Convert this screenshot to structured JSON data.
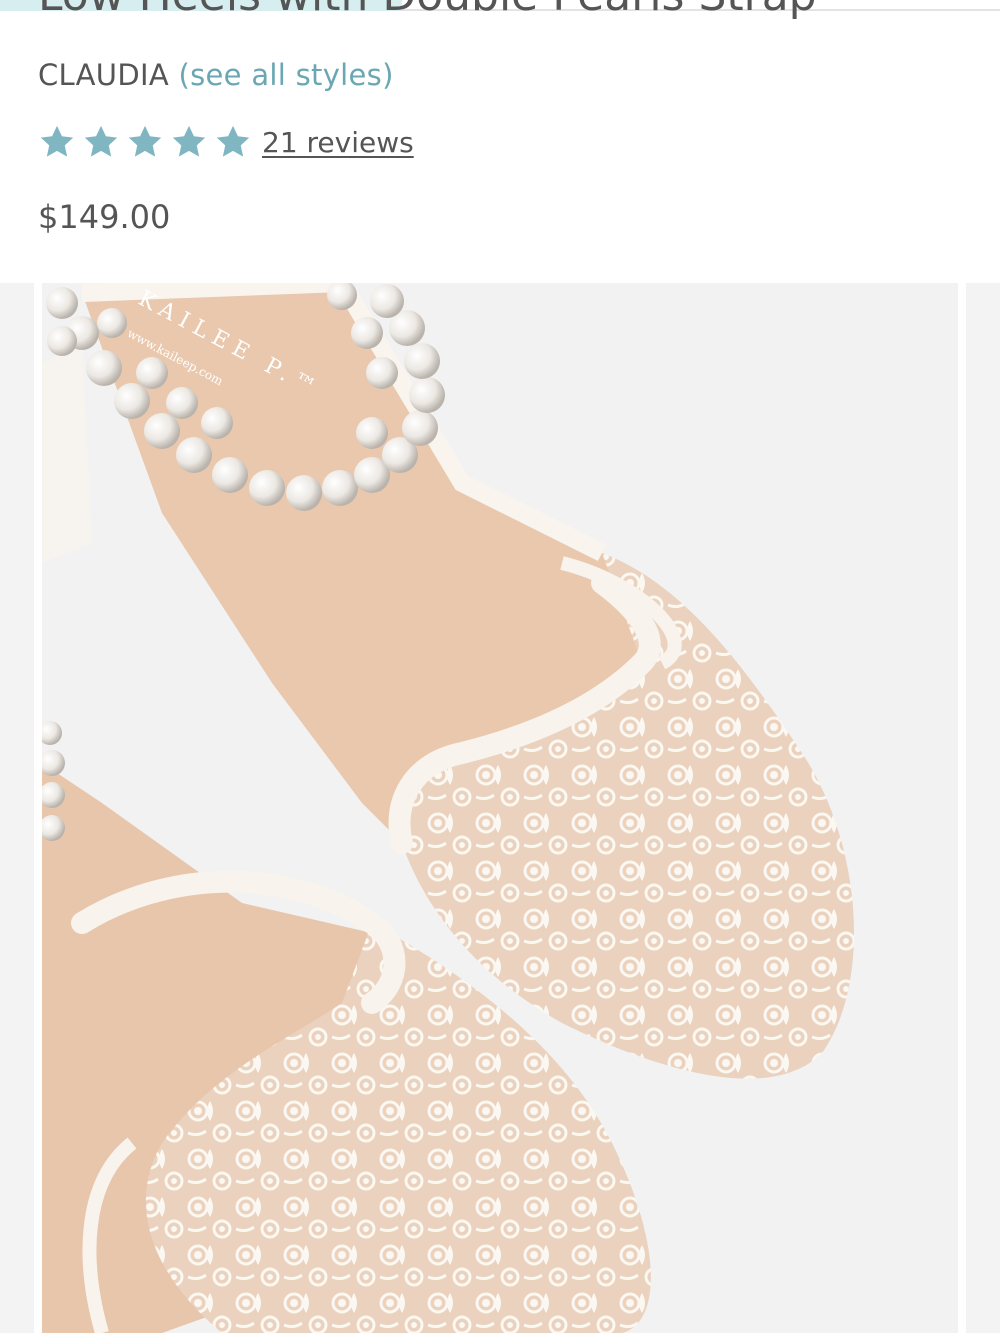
{
  "page": {
    "title_cut": "Low Heels with Double Pearls Strap"
  },
  "product": {
    "brand": "CLAUDIA",
    "see_all": "(see all styles)",
    "rating": 5,
    "reviews_label": "21 reviews",
    "price": "$149.00"
  },
  "image": {
    "brand_mark": "KAILEE P.™",
    "brand_url": "www.kaileep.com"
  },
  "colors": {
    "accent": "#6aa7b3",
    "star": "#7fb6c1"
  }
}
